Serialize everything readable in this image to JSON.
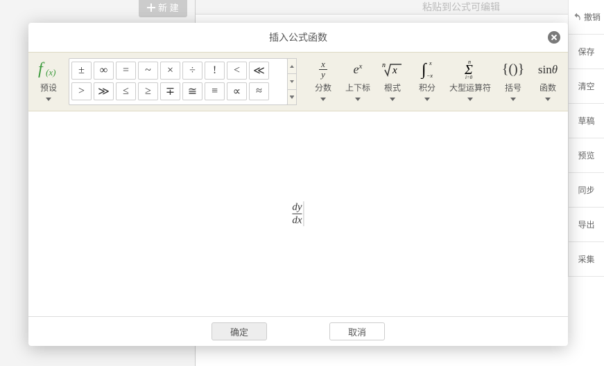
{
  "background": {
    "new_button": "新 建",
    "clip_text": "粘贴到公式可编辑"
  },
  "right_panel": {
    "items": [
      "撤销",
      "保存",
      "清空",
      "草稿",
      "预览",
      "同步",
      "导出",
      "采集"
    ]
  },
  "modal": {
    "title": "插入公式函数",
    "ok": "确定",
    "cancel": "取消"
  },
  "toolbar": {
    "preset_label": "预设",
    "preset_icon": "f(x)",
    "symbols_row1": [
      "±",
      "∞",
      "=",
      "~",
      "×",
      "÷",
      "!",
      "<",
      "≪"
    ],
    "symbols_row2": [
      ">",
      "≫",
      "≤",
      "≥",
      "∓",
      "≅",
      "≡",
      "∝",
      "≈"
    ],
    "groups": [
      {
        "key": "fraction",
        "label": "分数",
        "icon": "frac"
      },
      {
        "key": "subsup",
        "label": "上下标",
        "icon": "exp"
      },
      {
        "key": "radical",
        "label": "根式",
        "icon": "root"
      },
      {
        "key": "integral",
        "label": "积分",
        "icon": "integral"
      },
      {
        "key": "bigop",
        "label": "大型运算符",
        "icon": "sum"
      },
      {
        "key": "bracket",
        "label": "括号",
        "icon": "brace"
      },
      {
        "key": "function",
        "label": "函数",
        "icon": "sin"
      }
    ]
  },
  "formula": {
    "numerator": "dy",
    "denominator": "dx"
  }
}
